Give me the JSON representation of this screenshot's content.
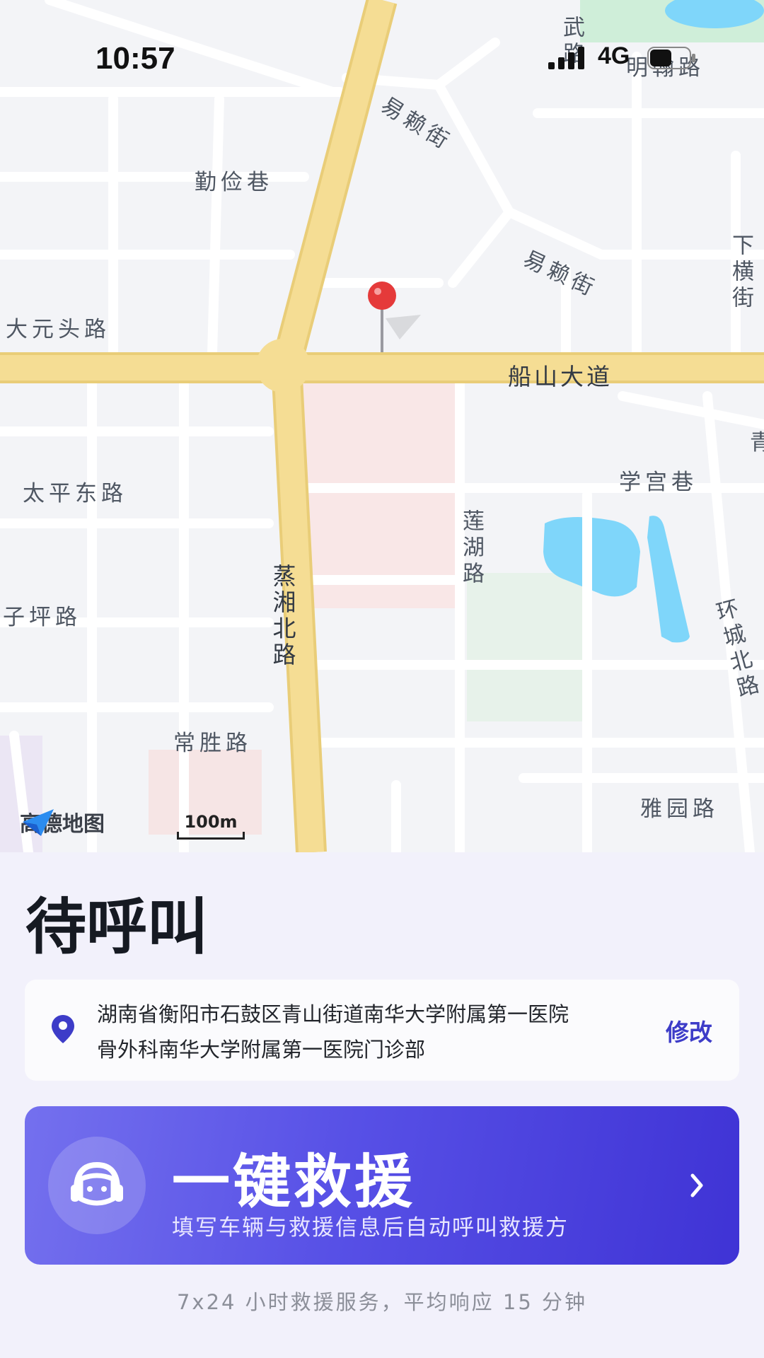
{
  "status_bar": {
    "time": "10:57",
    "network": "4G"
  },
  "map": {
    "roads": {
      "wu_lu": "武路",
      "ming_han_lu": "明翰路",
      "yi_lai_jie_1": "易赖街",
      "qin_jian_xiang": "勤俭巷",
      "yi_lai_jie_2": "易赖街",
      "xia_heng_jie": "下横街",
      "da_yuan_tou_lu": "大元头路",
      "chuan_shan_da_dao": "船山大道",
      "qing": "青",
      "xue_gong_xiang": "学宫巷",
      "tai_ping_dong_lu": "太平东路",
      "lian_hu_lu": "莲湖路",
      "zheng_xiang_bei_lu": "蒸湘北路",
      "zi_ping_lu": "子坪路",
      "huan_cheng_bei_lu": "环城北路",
      "chang_sheng_lu": "常胜路",
      "ya_yuan_lu": "雅园路"
    },
    "brand": "高德地图",
    "scale": "100m"
  },
  "status_title": "待呼叫",
  "address": {
    "text": "湖南省衡阳市石鼓区青山街道南华大学附属第一医院骨外科南华大学附属第一医院门诊部",
    "edit_label": "修改"
  },
  "rescue": {
    "title": "一键救援",
    "subtitle": "填写车辆与救援信息后自动呼叫救援方"
  },
  "footer": "7x24 小时救援服务，平均响应 15 分钟",
  "colors": {
    "accent": "#3d3cc8",
    "road_main": "#f3d98a",
    "water": "#7fd6fa",
    "pin": "#e53a3a"
  }
}
